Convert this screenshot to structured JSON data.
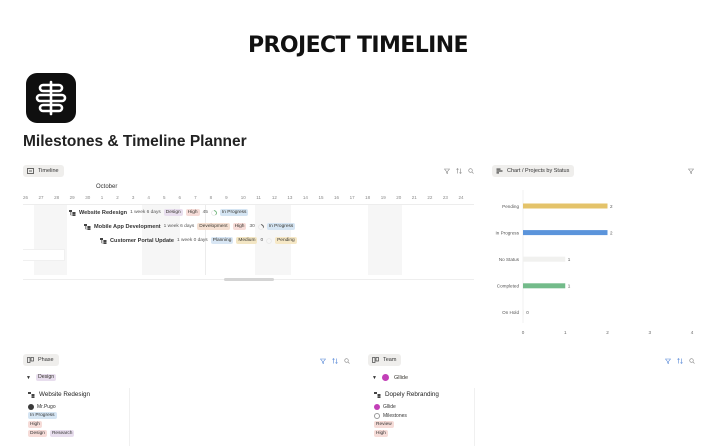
{
  "page": {
    "heading": "PROJECT TIMELINE",
    "title": "Milestones & Timeline Planner"
  },
  "timeline_view": {
    "tab_label": "Timeline",
    "month": "October",
    "days": [
      "26",
      "27",
      "28",
      "29",
      "30",
      "1",
      "2",
      "3",
      "4",
      "5",
      "6",
      "7",
      "8",
      "9",
      "10",
      "11",
      "12",
      "13",
      "14",
      "15",
      "16",
      "17",
      "18",
      "19",
      "20",
      "21",
      "22",
      "23",
      "24"
    ],
    "rows": [
      {
        "name": "Website Redesign",
        "duration": "1 week 6 days",
        "phase": "Design",
        "priority": "High",
        "progress": "45",
        "status": "In Progress"
      },
      {
        "name": "Mobile App Development",
        "duration": "1 week 6 days",
        "phase": "Development",
        "priority": "High",
        "progress": "30",
        "status": "In Progress"
      },
      {
        "name": "Customer Portal Update",
        "duration": "1 week 0 days",
        "phase": "Planning",
        "priority": "Medium",
        "progress": "0",
        "status": "Pending"
      }
    ]
  },
  "chart_view": {
    "tab_label": "Chart / Projects by Status"
  },
  "chart_data": {
    "type": "bar",
    "orientation": "horizontal",
    "categories": [
      "Pending",
      "In Progress",
      "No Status",
      "Completed",
      "On Hold"
    ],
    "values": [
      2,
      2,
      1,
      1,
      0
    ],
    "value_labels": [
      "2",
      "2",
      "1",
      "1",
      "0"
    ],
    "xlim": [
      0,
      4
    ],
    "xticks": [
      "0",
      "1",
      "2",
      "3",
      "4"
    ],
    "colors": [
      "#e4c36a",
      "#5b94db",
      "#f1f1ef",
      "#73bb8a",
      "#f1f1ef"
    ],
    "grid": false,
    "legend": "none"
  },
  "phase_view": {
    "tab_label": "Phase",
    "group": "Design",
    "card": {
      "title": "Website Redesign",
      "owner": "Mr.Pugo",
      "status": "In Progress",
      "priority": "High",
      "tags": [
        "Design",
        "Research"
      ]
    }
  },
  "team_view": {
    "tab_label": "Team",
    "group": "Gllide",
    "card": {
      "title": "Dopely Rebranding",
      "owner": "Gllide",
      "relation": "Milestones",
      "status": "Review",
      "priority": "High"
    }
  },
  "colors": {
    "design_chip": "#e8deee",
    "high_chip": "#f6dcd8",
    "in_progress_chip": "#d5e5f3",
    "development_chip": "#f5e0d2",
    "planning_chip": "#d8e6f4",
    "medium_chip": "#f3e6c4",
    "pending_chip": "#f6e8c6"
  }
}
